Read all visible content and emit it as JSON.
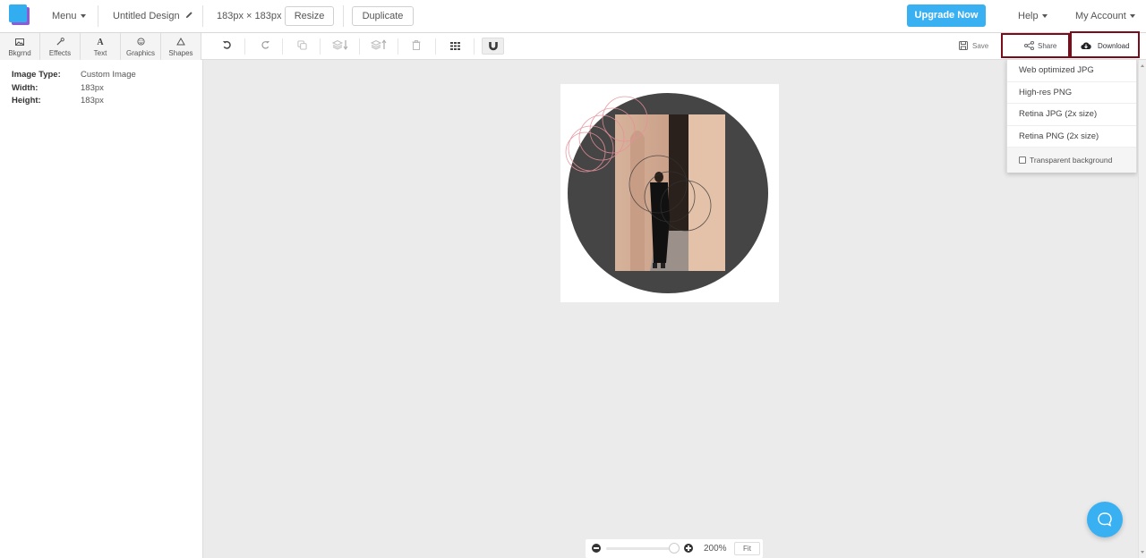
{
  "topbar": {
    "menu_label": "Menu",
    "design_title": "Untitled Design",
    "dimensions": "183px × 183px",
    "resize_label": "Resize",
    "duplicate_label": "Duplicate",
    "upgrade_label": "Upgrade Now",
    "help_label": "Help",
    "account_label": "My Account",
    "brand_color": "#38b0f2"
  },
  "tools": [
    {
      "label": "Bkgrnd",
      "icon": "image-icon"
    },
    {
      "label": "Effects",
      "icon": "magic-wand-icon"
    },
    {
      "label": "Text",
      "icon": "text-icon"
    },
    {
      "label": "Graphics",
      "icon": "smiley-icon"
    },
    {
      "label": "Shapes",
      "icon": "triangle-icon"
    }
  ],
  "actions": {
    "save_label": "Save",
    "share_label": "Share",
    "download_label": "Download",
    "highlight_color": "#7b0c1b"
  },
  "download_menu": {
    "items": [
      "Web optimized JPG",
      "High-res PNG",
      "Retina JPG (2x size)",
      "Retina PNG (2x size)"
    ],
    "transparent_label": "Transparent background",
    "transparent_checked": false
  },
  "properties": {
    "image_type_label": "Image Type:",
    "image_type_value": "Custom Image",
    "width_label": "Width:",
    "width_value": "183px",
    "height_label": "Height:",
    "height_value": "183px"
  },
  "zoom": {
    "level": "200%",
    "slider_fraction": 1.0,
    "fit_label": "Fit"
  }
}
